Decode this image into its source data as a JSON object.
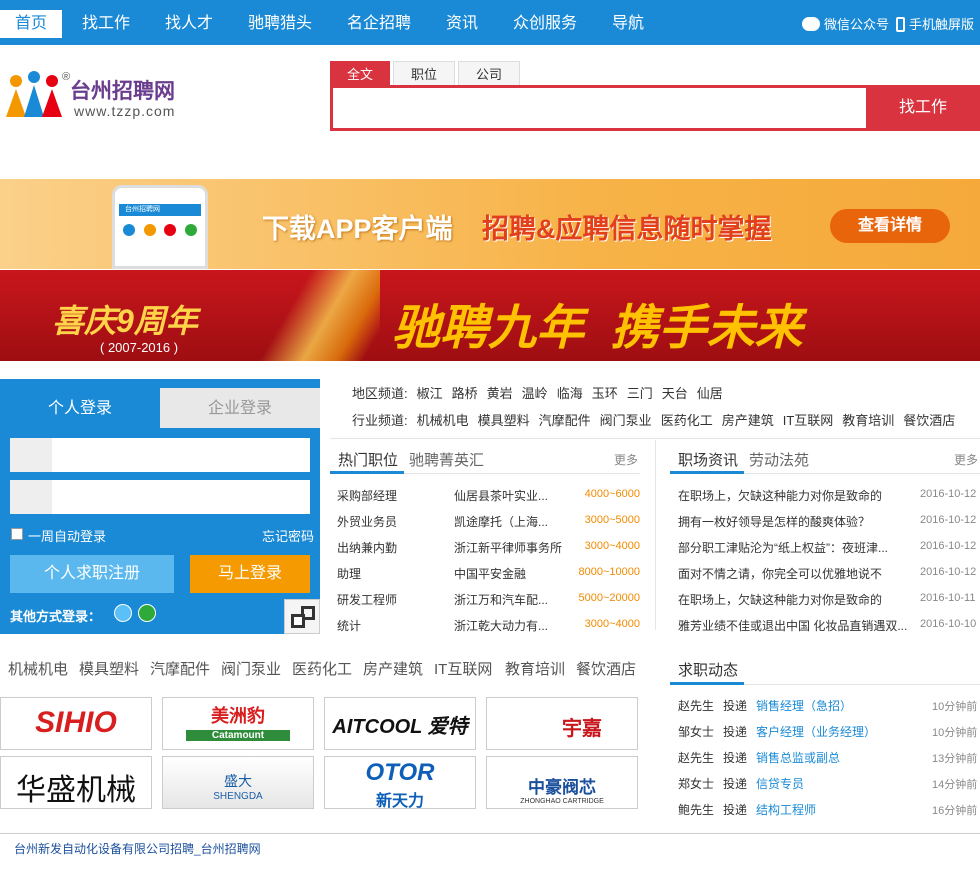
{
  "nav": {
    "items": [
      "首页",
      "找工作",
      "找人才",
      "驰聘猎头",
      "名企招聘",
      "资讯",
      "众创服务",
      "导航"
    ],
    "wechat": "微信公众号",
    "mobile": "手机触屏版"
  },
  "logo": {
    "name": "台州招聘网",
    "url": "www.tzzp.com",
    "mark": "®"
  },
  "search": {
    "tabs": [
      "全文",
      "职位",
      "公司"
    ],
    "button": "找工作",
    "value": ""
  },
  "banner1": {
    "phone_title": "台州招聘网",
    "text1": "下载APP客户端",
    "text2": "招聘&应聘信息随时掌握",
    "button": "查看详情"
  },
  "banner2": {
    "left": "喜庆9周年",
    "years": "( 2007-2016 )",
    "right": "驰聘九年  携手未来"
  },
  "login": {
    "tabs": [
      "个人登录",
      "企业登录"
    ],
    "remember": "一周自动登录",
    "forgot": "忘记密码",
    "register": "个人求职注册",
    "login_btn": "马上登录",
    "other": "其他方式登录："
  },
  "channels": {
    "area_label": "地区频道:",
    "areas": [
      "椒江",
      "路桥",
      "黄岩",
      "温岭",
      "临海",
      "玉环",
      "三门",
      "天台",
      "仙居"
    ],
    "industry_label": "行业频道:",
    "industries": [
      "机械机电",
      "模具塑料",
      "汽摩配件",
      "阀门泵业",
      "医药化工",
      "房产建筑",
      "IT互联网",
      "教育培训",
      "餐饮酒店"
    ]
  },
  "hotjobs": {
    "tabs": [
      "热门职位",
      "驰聘菁英汇"
    ],
    "more": "更多",
    "rows": [
      {
        "job": "采购部经理",
        "company": "仙居县茶叶实业...",
        "salary": "4000~6000"
      },
      {
        "job": "外贸业务员",
        "company": "凯途摩托（上海...",
        "salary": "3000~5000"
      },
      {
        "job": "出纳兼内勤",
        "company": "浙江新平律师事务所",
        "salary": "3000~4000"
      },
      {
        "job": "助理",
        "company": "中国平安金融",
        "salary": "8000~10000"
      },
      {
        "job": "研发工程师",
        "company": "浙江万和汽车配...",
        "salary": "5000~20000"
      },
      {
        "job": "统计",
        "company": "浙江乾大动力有...",
        "salary": "3000~4000"
      }
    ]
  },
  "news": {
    "tabs": [
      "职场资讯",
      "劳动法苑"
    ],
    "more": "更多",
    "rows": [
      {
        "title": "在职场上，欠缺这种能力对你是致命的",
        "date": "2016-10-12"
      },
      {
        "title": "拥有一枚好领导是怎样的酸爽体验？",
        "date": "2016-10-12"
      },
      {
        "title": "部分职工津贴沦为“纸上权益”：夜班津...",
        "date": "2016-10-12"
      },
      {
        "title": "面对不情之请，你完全可以优雅地说不",
        "date": "2016-10-12"
      },
      {
        "title": "在职场上，欠缺这种能力对你是致命的",
        "date": "2016-10-11"
      },
      {
        "title": "雅芳业绩不佳或退出中国 化妆品直销遇双...",
        "date": "2016-10-10"
      }
    ]
  },
  "industry_bar": [
    "机械机电",
    "模具塑料",
    "汽摩配件",
    "阀门泵业",
    "医药化工",
    "房产建筑",
    "IT互联网",
    "教育培训",
    "餐饮酒店"
  ],
  "company_logos": [
    {
      "text": "SIHIO",
      "sub": "®"
    },
    {
      "text": "美洲豹",
      "sub": "Catamount"
    },
    {
      "text": "AITCOOL 爱特",
      "sub": ""
    },
    {
      "text": "宇嘉",
      "sub": ""
    },
    {
      "text": "华盛机械",
      "sub": ""
    },
    {
      "text": "盛大",
      "sub": "SHENGDA"
    },
    {
      "text": "OTOR",
      "sub": "新天力"
    },
    {
      "text": "中豪阀芯",
      "sub": "ZHONGHAO CARTRIDGE"
    }
  ],
  "dynamics": {
    "title": "求职动态",
    "rows": [
      {
        "name": "赵先生",
        "action": "投递",
        "job": "销售经理（急招）",
        "time": "10分钟前"
      },
      {
        "name": "邹女士",
        "action": "投递",
        "job": "客户经理（业务经理）",
        "time": "10分钟前"
      },
      {
        "name": "赵先生",
        "action": "投递",
        "job": "销售总监或副总",
        "time": "13分钟前"
      },
      {
        "name": "郑女士",
        "action": "投递",
        "job": "信贷专员",
        "time": "14分钟前"
      },
      {
        "name": "鲍先生",
        "action": "投递",
        "job": "结构工程师",
        "time": "16分钟前"
      }
    ]
  },
  "status": {
    "text": "台州新发自动化设备有限公司招聘_台州招聘网"
  },
  "colors": {
    "blue": "#1a8ad6",
    "red": "#d9333f",
    "orange": "#f08a00",
    "green": "#2eaa3a"
  }
}
